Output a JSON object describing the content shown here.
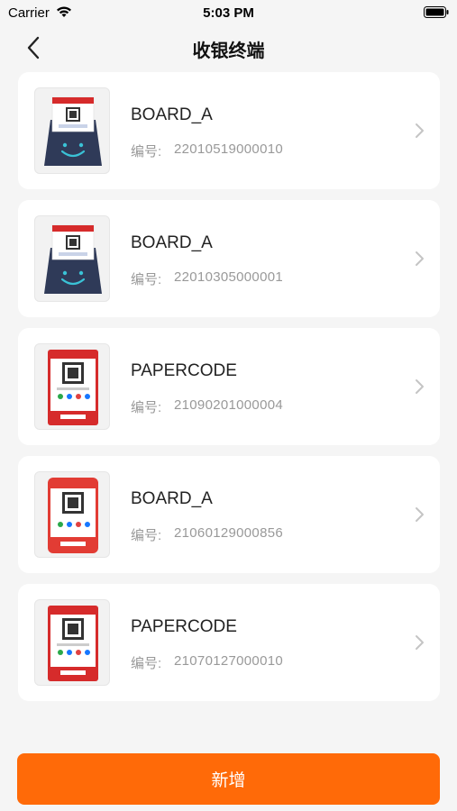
{
  "status_bar": {
    "carrier": "Carrier",
    "time": "5:03 PM"
  },
  "header": {
    "title": "收银终端"
  },
  "devices": [
    {
      "name": "BOARD_A",
      "serial_label": "编号:",
      "serial": "22010519000010",
      "thumbnail": "board-stand-icon"
    },
    {
      "name": "BOARD_A",
      "serial_label": "编号:",
      "serial": "22010305000001",
      "thumbnail": "board-stand-icon"
    },
    {
      "name": "PAPERCODE",
      "serial_label": "编号:",
      "serial": "21090201000004",
      "thumbnail": "paper-code-icon"
    },
    {
      "name": "BOARD_A",
      "serial_label": "编号:",
      "serial": "21060129000856",
      "thumbnail": "paper-code-icon"
    },
    {
      "name": "PAPERCODE",
      "serial_label": "编号:",
      "serial": "21070127000010",
      "thumbnail": "paper-code-icon"
    }
  ],
  "footer": {
    "add_label": "新增"
  },
  "colors": {
    "accent": "#ff6a08",
    "background": "#f5f5f5",
    "card": "#ffffff"
  }
}
